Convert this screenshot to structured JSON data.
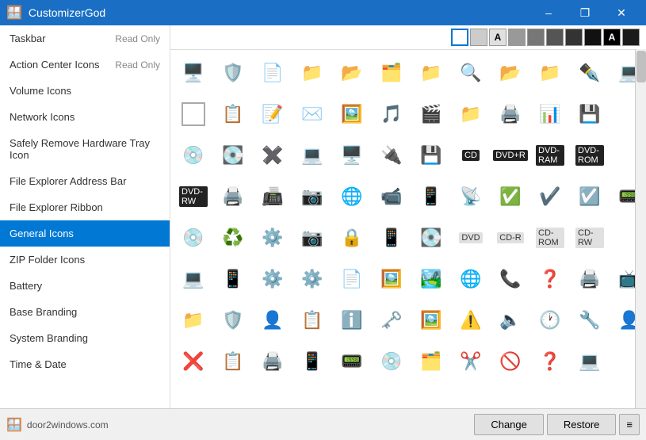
{
  "app": {
    "title": "CustomizerGod",
    "window_controls": {
      "minimize": "–",
      "maximize": "❐",
      "close": "✕"
    }
  },
  "sidebar": {
    "items": [
      {
        "label": "Taskbar",
        "badge": "Read Only",
        "active": false
      },
      {
        "label": "Action Center Icons",
        "badge": "Read Only",
        "active": false
      },
      {
        "label": "Volume Icons",
        "badge": "",
        "active": false
      },
      {
        "label": "Network Icons",
        "badge": "",
        "active": false
      },
      {
        "label": "Safely Remove Hardware Tray Icon",
        "badge": "",
        "active": false
      },
      {
        "label": "File Explorer Address Bar",
        "badge": "",
        "active": false
      },
      {
        "label": "File Explorer Ribbon",
        "badge": "",
        "active": false
      },
      {
        "label": "General Icons",
        "badge": "",
        "active": true
      },
      {
        "label": "ZIP Folder Icons",
        "badge": "",
        "active": false
      },
      {
        "label": "Battery",
        "badge": "",
        "active": false
      },
      {
        "label": "Base Branding",
        "badge": "",
        "active": false
      },
      {
        "label": "System Branding",
        "badge": "",
        "active": false
      },
      {
        "label": "Time & Date",
        "badge": "",
        "active": false
      }
    ]
  },
  "toolbar": {
    "colors": [
      "#ffffff",
      "#cccccc",
      "#999999",
      "#666666",
      "#333333",
      "#000000"
    ],
    "has_letter_A": true
  },
  "bottom": {
    "website": "door2windows.com",
    "change_label": "Change",
    "restore_label": "Restore",
    "menu_label": "≡"
  }
}
